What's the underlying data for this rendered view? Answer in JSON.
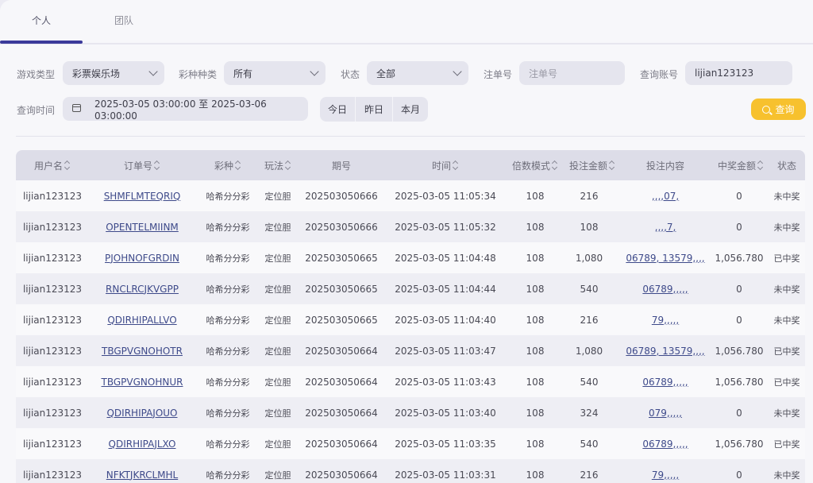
{
  "tabs": [
    {
      "label": "个人",
      "active": true
    },
    {
      "label": "团队",
      "active": false
    }
  ],
  "filters": {
    "game_type_label": "游戏类型",
    "game_type_value": "彩票娱乐场",
    "lottery_kind_label": "彩种种类",
    "lottery_kind_value": "所有",
    "status_label": "状态",
    "status_value": "全部",
    "order_no_label": "注单号",
    "order_no_placeholder": "注单号",
    "account_label": "查询账号",
    "account_value": "lijian123123",
    "time_label": "查询时间",
    "time_value": "2025-03-05 03:00:00 至 2025-03-06 03:00:00",
    "quick_today": "今日",
    "quick_yesterday": "昨日",
    "quick_month": "本月",
    "search_label": "查询"
  },
  "table": {
    "headers": [
      "用户名",
      "订单号",
      "彩种",
      "玩法",
      "期号",
      "时间",
      "倍数模式",
      "投注金额",
      "投注内容",
      "中奖金额",
      "状态"
    ],
    "rows": [
      {
        "user": "lijian123123",
        "order": "SHMFLMTEQRIQ",
        "lottery": "哈希分分彩",
        "play": "定位胆",
        "issue": "202503050666",
        "time": "2025-03-05 11:05:34",
        "multiple": "108",
        "amount": "216",
        "content": ",,,,07,",
        "win": "0",
        "status": "未中奖"
      },
      {
        "user": "lijian123123",
        "order": "OPENTELMIINM",
        "lottery": "哈希分分彩",
        "play": "定位胆",
        "issue": "202503050666",
        "time": "2025-03-05 11:05:32",
        "multiple": "108",
        "amount": "108",
        "content": ",,,,7,",
        "win": "0",
        "status": "未中奖"
      },
      {
        "user": "lijian123123",
        "order": "PJOHNOFGRDIN",
        "lottery": "哈希分分彩",
        "play": "定位胆",
        "issue": "202503050665",
        "time": "2025-03-05 11:04:48",
        "multiple": "108",
        "amount": "1,080",
        "content": "06789, 13579,,,,",
        "win": "1,056.780",
        "status": "已中奖"
      },
      {
        "user": "lijian123123",
        "order": "RNCLRCJKVGPP",
        "lottery": "哈希分分彩",
        "play": "定位胆",
        "issue": "202503050665",
        "time": "2025-03-05 11:04:44",
        "multiple": "108",
        "amount": "540",
        "content": "06789,,,,,",
        "win": "0",
        "status": "未中奖"
      },
      {
        "user": "lijian123123",
        "order": "QDIRHIPALLVO",
        "lottery": "哈希分分彩",
        "play": "定位胆",
        "issue": "202503050665",
        "time": "2025-03-05 11:04:40",
        "multiple": "108",
        "amount": "216",
        "content": "79,,,,,",
        "win": "0",
        "status": "未中奖"
      },
      {
        "user": "lijian123123",
        "order": "TBGPVGNOHOTR",
        "lottery": "哈希分分彩",
        "play": "定位胆",
        "issue": "202503050664",
        "time": "2025-03-05 11:03:47",
        "multiple": "108",
        "amount": "1,080",
        "content": "06789, 13579,,,,",
        "win": "1,056.780",
        "status": "已中奖"
      },
      {
        "user": "lijian123123",
        "order": "TBGPVGNOHNUR",
        "lottery": "哈希分分彩",
        "play": "定位胆",
        "issue": "202503050664",
        "time": "2025-03-05 11:03:43",
        "multiple": "108",
        "amount": "540",
        "content": "06789,,,,,",
        "win": "1,056.780",
        "status": "已中奖"
      },
      {
        "user": "lijian123123",
        "order": "QDIRHIPAJOUO",
        "lottery": "哈希分分彩",
        "play": "定位胆",
        "issue": "202503050664",
        "time": "2025-03-05 11:03:40",
        "multiple": "108",
        "amount": "324",
        "content": "079,,,,,",
        "win": "0",
        "status": "未中奖"
      },
      {
        "user": "lijian123123",
        "order": "QDIRHIPAJLXO",
        "lottery": "哈希分分彩",
        "play": "定位胆",
        "issue": "202503050664",
        "time": "2025-03-05 11:03:35",
        "multiple": "108",
        "amount": "540",
        "content": "06789,,,,,",
        "win": "1,056.780",
        "status": "已中奖"
      },
      {
        "user": "lijian123123",
        "order": "NFKTJKRCLMHL",
        "lottery": "哈希分分彩",
        "play": "定位胆",
        "issue": "202503050664",
        "time": "2025-03-05 11:03:31",
        "multiple": "108",
        "amount": "216",
        "content": "79,,,,,",
        "win": "0",
        "status": "未中奖"
      }
    ]
  },
  "colors": {
    "accent": "#3b3a9a",
    "search": "#f7c12e",
    "header_bg": "#dddde8"
  }
}
